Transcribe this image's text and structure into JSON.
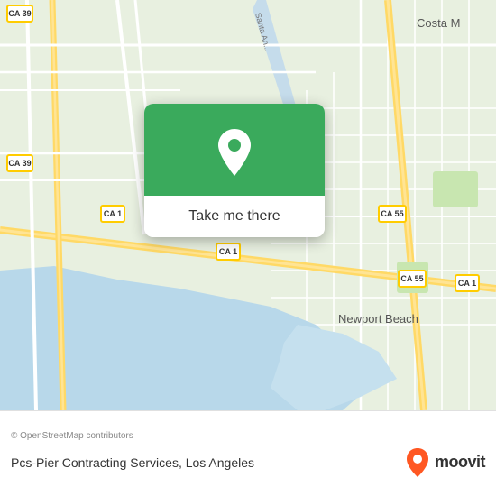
{
  "map": {
    "attribution": "© OpenStreetMap contributors",
    "background_color": "#e8f0e0",
    "water_color": "#b0d4e8",
    "road_color": "#ffffff",
    "highway_color": "#ffd966"
  },
  "popup": {
    "button_label": "Take me there",
    "icon": "location-pin"
  },
  "bottom_bar": {
    "attribution": "© OpenStreetMap contributors",
    "place_name": "Pcs-Pier Contracting Services, Los Angeles",
    "moovit_label": "moovit"
  },
  "road_labels": {
    "ca1_a": "CA 1",
    "ca1_b": "CA 1",
    "ca1_c": "CA 1",
    "ca39": "CA 39",
    "ca55_a": "CA 55",
    "ca55_b": "CA 55"
  }
}
